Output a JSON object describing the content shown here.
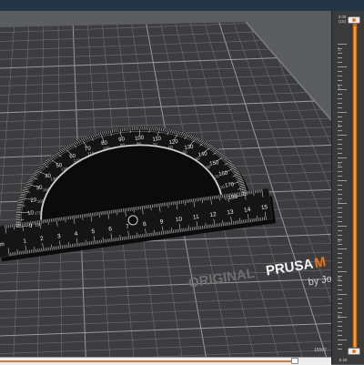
{
  "sidebar": {
    "layer_top": "3.00",
    "layer_top_index": "(15)",
    "layer_bottom": "0.20",
    "tick_labels": [
      "1.",
      "1.",
      "1.",
      "1.",
      "1.",
      "0.",
      "0.",
      "0."
    ]
  },
  "hslider": {
    "value": "15567"
  },
  "viewport": {
    "bed_logo_main": "ORIGINAL",
    "bed_logo_brand": "PRUSA",
    "bed_logo_accent": "M",
    "bed_logo_sub": "by Jo",
    "protractor_outer_labels": [
      "0",
      "10",
      "20",
      "30",
      "40",
      "50",
      "60",
      "70",
      "80",
      "90",
      "100",
      "110",
      "120",
      "130",
      "140",
      "150",
      "160",
      "170",
      "180"
    ],
    "protractor_inner_labels": [
      "180",
      "170",
      "160",
      "150",
      "140",
      "130",
      "120",
      "110",
      "100",
      "90",
      "80",
      "70",
      "60",
      "50",
      "40",
      "30",
      "20",
      "10",
      "0"
    ],
    "ruler_labels": [
      "cm",
      "1",
      "2",
      "3",
      "4",
      "5",
      "6",
      "7",
      "8",
      "9",
      "10",
      "11",
      "12",
      "13",
      "14",
      "15"
    ]
  },
  "colors": {
    "accent": "#e8741a",
    "bed": "#3c3c3c",
    "grid": "#8a8a8a",
    "model": "#141414"
  }
}
